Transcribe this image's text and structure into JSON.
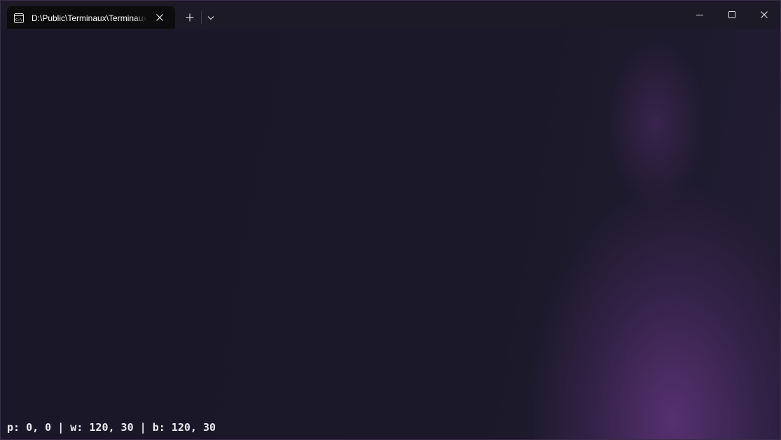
{
  "tab": {
    "title": "D:\\Public\\Terminaux\\Terminaux",
    "icon": "terminal-icon"
  },
  "titlebar": {
    "new_tab_icon": "plus-icon",
    "dropdown_icon": "chevron-down-icon",
    "minimize_icon": "minimize-icon",
    "maximize_icon": "maximize-icon",
    "close_icon": "close-icon"
  },
  "terminal": {
    "status_line": "p: 0, 0 | w: 120, 30 | b: 120, 30"
  },
  "colors": {
    "background": "#1b1929",
    "accent_glow": "#5a3278",
    "tab_background": "#0c0c0c",
    "text": "#ededf2"
  }
}
